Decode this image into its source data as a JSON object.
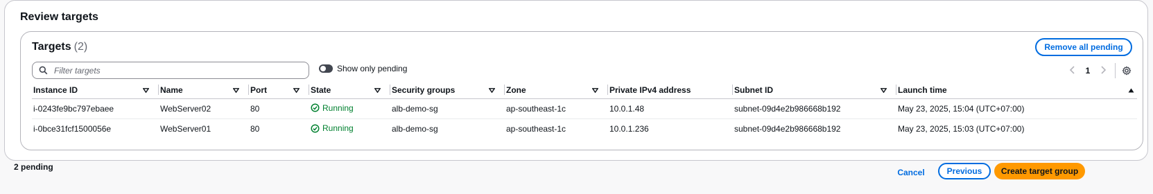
{
  "section": {
    "title": "Review targets"
  },
  "targets_panel": {
    "title": "Targets",
    "count": "(2)",
    "remove_button": "Remove all pending",
    "filter_placeholder": "Filter targets",
    "toggle_label": "Show only pending",
    "pagination": {
      "current_page": "1"
    }
  },
  "table": {
    "columns": [
      "Instance ID",
      "Name",
      "Port",
      "State",
      "Security groups",
      "Zone",
      "Private IPv4 address",
      "Subnet ID",
      "Launch time"
    ],
    "rows": [
      {
        "instance_id": "i-0243fe9bc797ebaee",
        "name": "WebServer02",
        "port": "80",
        "state": "Running",
        "security_groups": "alb-demo-sg",
        "zone": "ap-southeast-1c",
        "private_ip": "10.0.1.48",
        "subnet_id": "subnet-09d4e2b986668b192",
        "launch_time": "May 23, 2025, 15:04 (UTC+07:00)"
      },
      {
        "instance_id": "i-0bce31fcf1500056e",
        "name": "WebServer01",
        "port": "80",
        "state": "Running",
        "security_groups": "alb-demo-sg",
        "zone": "ap-southeast-1c",
        "private_ip": "10.0.1.236",
        "subnet_id": "subnet-09d4e2b986668b192",
        "launch_time": "May 23, 2025, 15:03 (UTC+07:00)"
      }
    ]
  },
  "footer": {
    "pending_text": "2 pending",
    "cancel_label": "Cancel",
    "previous_label": "Previous",
    "create_label": "Create target group"
  },
  "colors": {
    "accent": "#006ce0",
    "primary_button": "#ff9900",
    "status_success": "#00802f"
  },
  "icons": {
    "filter": "search-icon",
    "sort": "caret-down-icon",
    "sorted": "caret-up-icon",
    "settings": "gear-icon",
    "status": "check-circle-icon"
  }
}
